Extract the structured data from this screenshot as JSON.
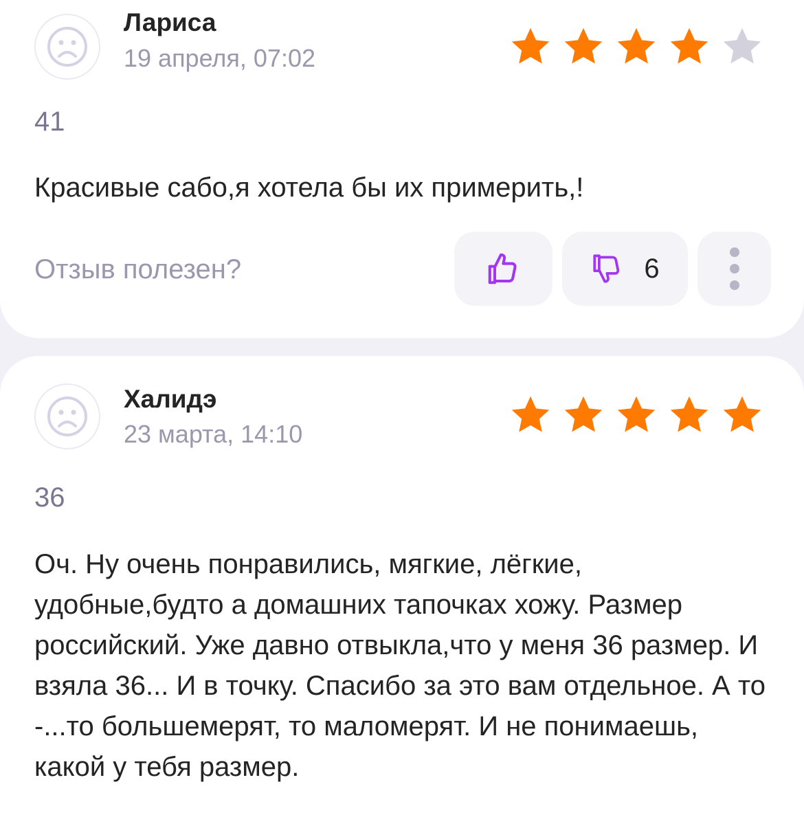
{
  "colors": {
    "star_filled": "#ff7a00",
    "star_empty": "#d3d2dc",
    "accent": "#a435f0",
    "secondary_text": "#9b97ad"
  },
  "reviews": [
    {
      "author": "Лариса",
      "date": "19 апреля, 07:02",
      "rating": 4,
      "size": "41",
      "text": "Красивые сабо,я хотела бы их примерить,!",
      "helpful_prompt": "Отзыв полезен?",
      "dislike_count": "6",
      "like_icon": "thumbs-up-icon",
      "dislike_icon": "thumbs-down-icon",
      "more_icon": "more-vertical-icon",
      "avatar_icon": "sad-face-avatar-icon"
    },
    {
      "author": "Халидэ",
      "date": "23 марта, 14:10",
      "rating": 5,
      "size": "36",
      "text": "Оч. Ну очень понравились, мягкие, лёгкие, удобные,будто а домашних тапочках хожу. Размер российский. Уже давно отвыкла,что у меня 36 размер. И взяла 36... И в точку.  Спасибо за это вам отдельное.  А то -...то большемерят, то маломерят. И не понимаешь, какой у тебя размер.",
      "avatar_icon": "sad-face-avatar-icon"
    }
  ]
}
